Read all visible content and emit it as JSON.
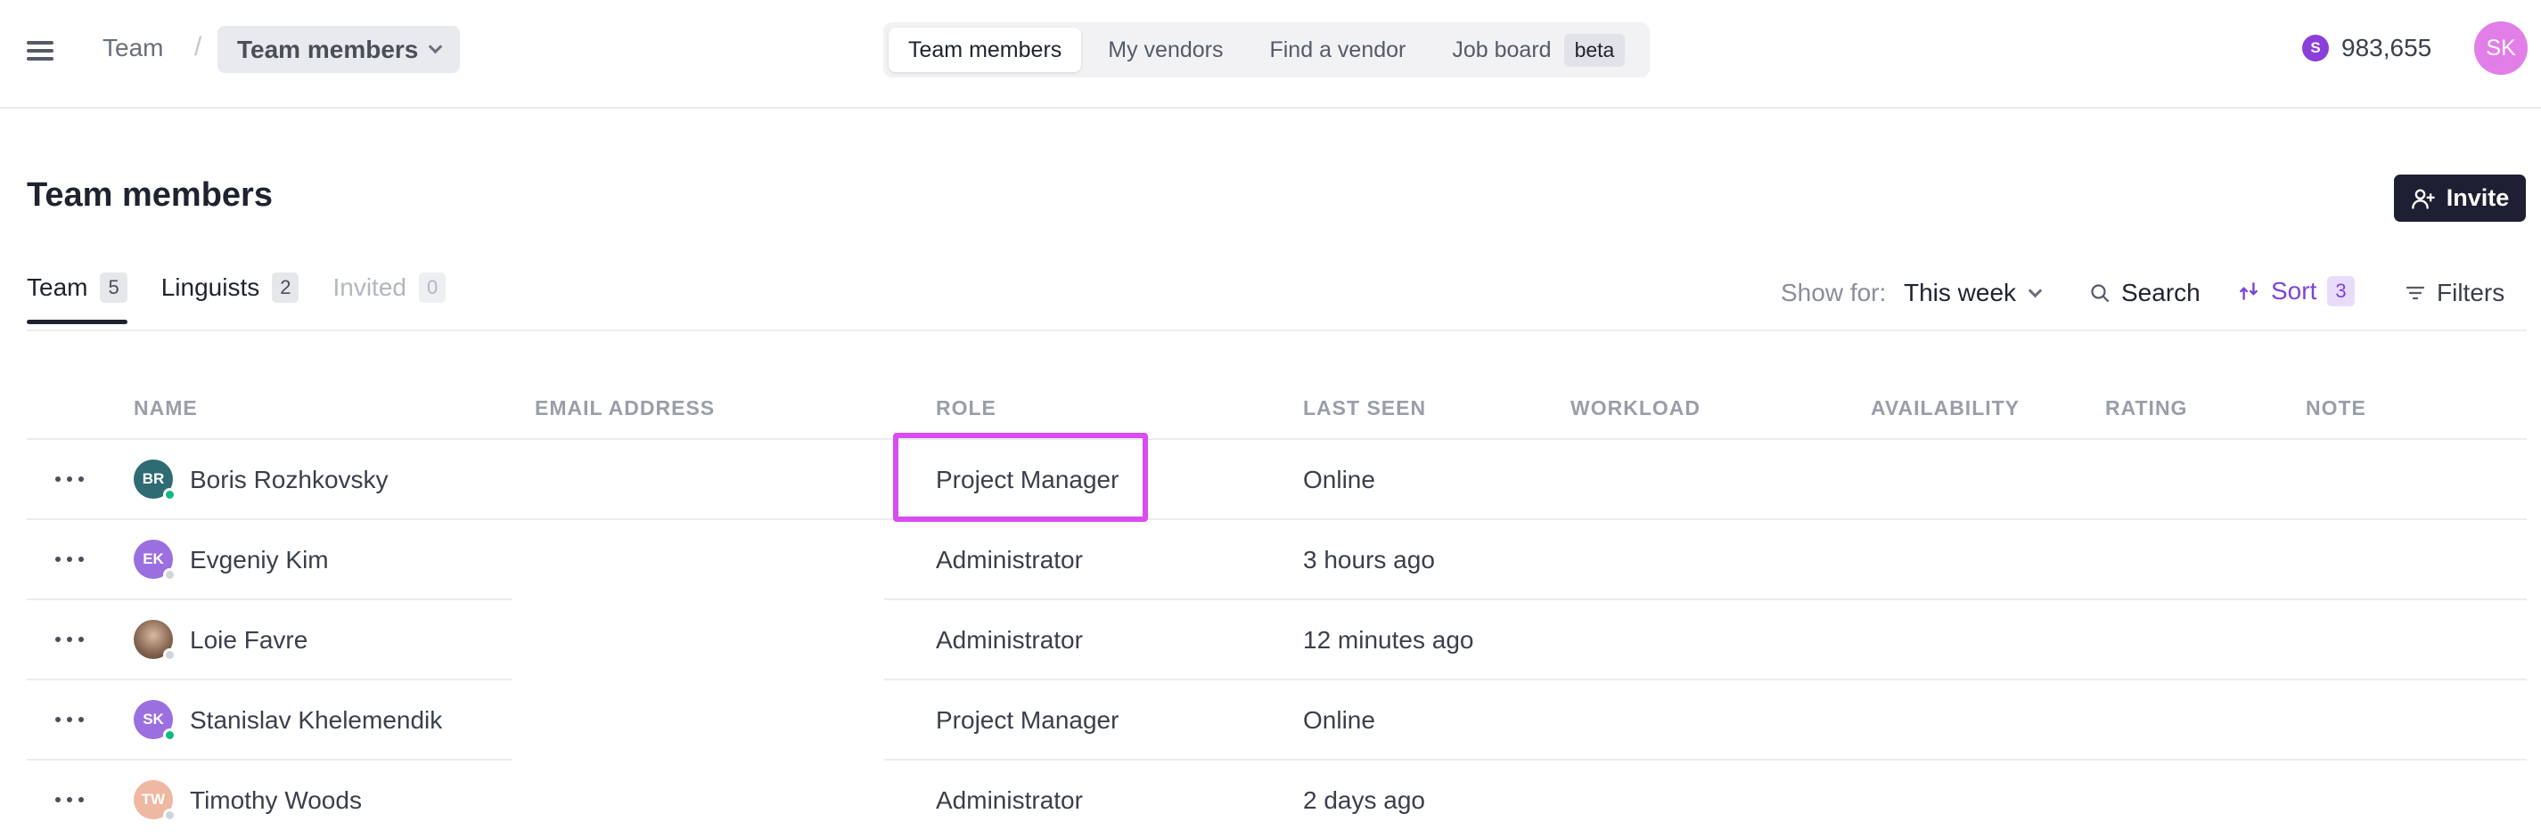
{
  "topbar": {
    "breadcrumb_root": "Team",
    "breadcrumb_sep": "/",
    "breadcrumb_current": "Team members",
    "nav_tabs": [
      {
        "label": "Team members",
        "active": true
      },
      {
        "label": "My vendors"
      },
      {
        "label": "Find a vendor"
      },
      {
        "label": "Job board",
        "badge": "beta"
      }
    ],
    "credits_icon": "S",
    "credits": "983,655",
    "user_initials": "SK"
  },
  "page": {
    "title": "Team members",
    "invite_label": "Invite"
  },
  "tabs": [
    {
      "label": "Team",
      "count": "5"
    },
    {
      "label": "Linguists",
      "count": "2"
    },
    {
      "label": "Invited",
      "count": "0"
    }
  ],
  "toolbar": {
    "show_for_label": "Show for:",
    "period": "This week",
    "search_label": "Search",
    "sort_label": "Sort",
    "sort_count": "3",
    "filters_label": "Filters"
  },
  "table": {
    "columns": [
      "NAME",
      "EMAIL ADDRESS",
      "ROLE",
      "LAST SEEN",
      "WORKLOAD",
      "AVAILABILITY",
      "RATING",
      "NOTE"
    ],
    "rows": [
      {
        "initials": "BR",
        "name": "Boris Rozhkovsky",
        "role": "Project Manager",
        "last_seen": "Online"
      },
      {
        "initials": "EK",
        "name": "Evgeniy Kim",
        "role": "Administrator",
        "last_seen": "3 hours ago"
      },
      {
        "initials": "",
        "name": "Loie Favre",
        "role": "Administrator",
        "last_seen": "12 minutes ago"
      },
      {
        "initials": "SK",
        "name": "Stanislav Khelemendik",
        "role": "Project Manager",
        "last_seen": "Online"
      },
      {
        "initials": "TW",
        "name": "Timothy Woods",
        "role": "Administrator",
        "last_seen": "2 days ago"
      }
    ]
  },
  "colors": {
    "accent_purple": "#7b45d6",
    "online": "#10b981",
    "offline": "#d1d5db",
    "highlight": "#d94cf0",
    "avatar_br": "#2f6b73",
    "avatar_ek": "#9b6fe0",
    "avatar_sk": "#9b6fe0",
    "avatar_tw": "#efb8a2"
  }
}
